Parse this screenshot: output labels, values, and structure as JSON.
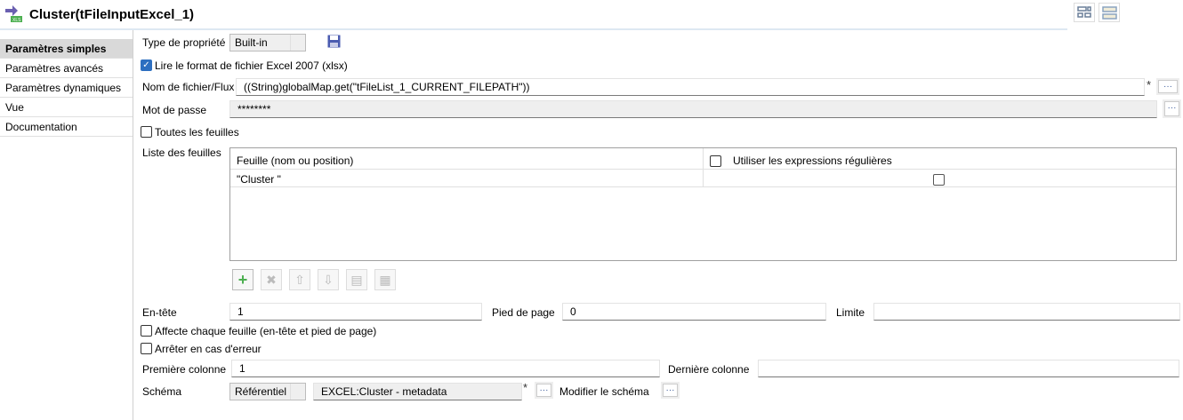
{
  "header": {
    "title": "Cluster(tFileInputExcel_1)",
    "icon": "excel-input-icon"
  },
  "sidebar": {
    "items": [
      {
        "label": "Paramètres simples",
        "selected": true
      },
      {
        "label": "Paramètres avancés"
      },
      {
        "label": "Paramètres dynamiques"
      },
      {
        "label": "Vue"
      },
      {
        "label": "Documentation"
      }
    ]
  },
  "form": {
    "property_type_label": "Type de propriété",
    "property_type_value": "Built-in",
    "xlsx_label": "Lire le format de fichier Excel 2007 (xlsx)",
    "xlsx_checked": true,
    "filename_label": "Nom de fichier/Flux",
    "filename_value": "((String)globalMap.get(\"tFileList_1_CURRENT_FILEPATH\"))",
    "password_label": "Mot de passe",
    "password_value": "********",
    "all_sheets_label": "Toutes les feuilles",
    "all_sheets_checked": false,
    "sheets_label": "Liste des feuilles",
    "sheets_table": {
      "columns": [
        "Feuille (nom ou position)",
        "Utiliser les expressions régulières"
      ],
      "rows": [
        {
          "sheet": "\"Cluster \"",
          "regex": false
        }
      ]
    },
    "header_label": "En-tête",
    "header_value": "1",
    "footer_label": "Pied de page",
    "footer_value": "0",
    "limit_label": "Limite",
    "limit_value": "",
    "affect_label": "Affecte chaque feuille (en-tête et pied de page)",
    "affect_checked": false,
    "stop_label": "Arrêter en cas d'erreur",
    "stop_checked": false,
    "first_col_label": "Première colonne",
    "first_col_value": "1",
    "last_col_label": "Dernière colonne",
    "last_col_value": "",
    "schema_label": "Schéma",
    "schema_type": "Référentiel",
    "schema_value": "EXCEL:Cluster - metadata",
    "edit_schema_label": "Modifier le schéma",
    "required_mark": "*",
    "dots": "···"
  }
}
